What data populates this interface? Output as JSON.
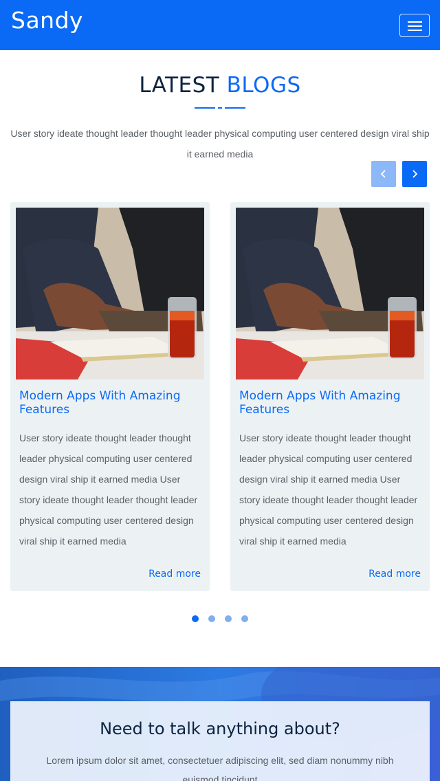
{
  "header": {
    "logo": "Sandy",
    "menu_icon": "hamburger-menu-icon",
    "bg_color": "#0b6af5"
  },
  "blogs": {
    "title_part1": "LATEST",
    "title_part2": "BLOGS",
    "intro": "User story ideate thought leader thought leader physical computing user centered design viral ship it earned media",
    "prev_icon": "chevron-left-icon",
    "next_icon": "chevron-right-icon",
    "cards": [
      {
        "title": "Modern Apps With Amazing Features",
        "text": "User story ideate thought leader thought leader physical computing user centered design viral ship it earned media User story ideate thought leader thought leader physical computing user centered design viral ship it earned media",
        "link": "Read more"
      },
      {
        "title": "Modern Apps With Amazing Features",
        "text": "User story ideate thought leader thought leader physical computing user centered design viral ship it earned media User story ideate thought leader thought leader physical computing user centered design viral ship it earned media",
        "link": "Read more"
      }
    ],
    "pagination": {
      "total": 4,
      "active": 1
    }
  },
  "contact": {
    "title": "Need to talk anything about?",
    "text": "Lorem ipsum dolor sit amet, consectetuer adipiscing elit, sed diam nonummy nibh euismod tincidunt"
  },
  "colors": {
    "accent": "#0b6af5",
    "heading": "#0d2340",
    "card_bg": "#ecf2f4"
  }
}
